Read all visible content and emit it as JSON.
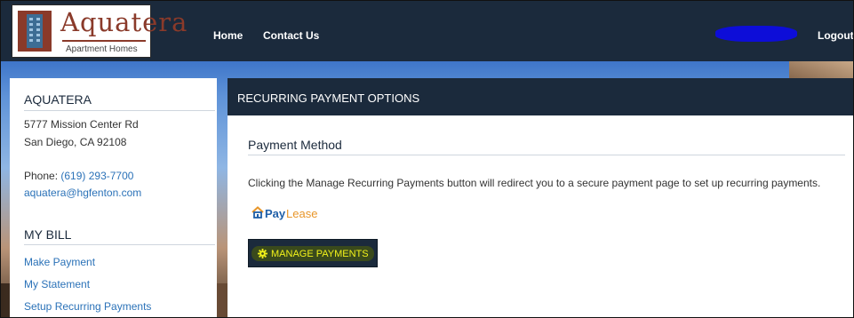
{
  "brand": {
    "name": "Aquatera",
    "subtitle": "Apartment Homes"
  },
  "nav": {
    "home": "Home",
    "contact": "Contact Us",
    "logout": "Logout"
  },
  "sidebar": {
    "property_heading": "AQUATERA",
    "address_line1": "5777 Mission Center Rd",
    "address_line2": "San Diego, CA 92108",
    "phone_label": "Phone:",
    "phone": "(619) 293-7700",
    "email": "aquatera@hgfenton.com",
    "bill_heading": "MY BILL",
    "links": [
      "Make Payment",
      "My Statement",
      "Setup Recurring Payments"
    ]
  },
  "main": {
    "title": "RECURRING PAYMENT OPTIONS",
    "section_title": "Payment Method",
    "info": "Clicking the Manage Recurring Payments button will redirect you to a secure payment page to set up recurring payments.",
    "paylease_pay": "Pay",
    "paylease_lease": "Lease",
    "button_label": "MANAGE PAYMENTS"
  },
  "colors": {
    "nav_bg": "#1b2a3c",
    "link": "#2b72b8",
    "brand": "#8a3a2a",
    "button_text": "#f2f21a",
    "paylease_orange": "#e8962a"
  },
  "icons": {
    "logo": "building-icon",
    "paylease": "house-icon",
    "button": "gear-icon"
  }
}
